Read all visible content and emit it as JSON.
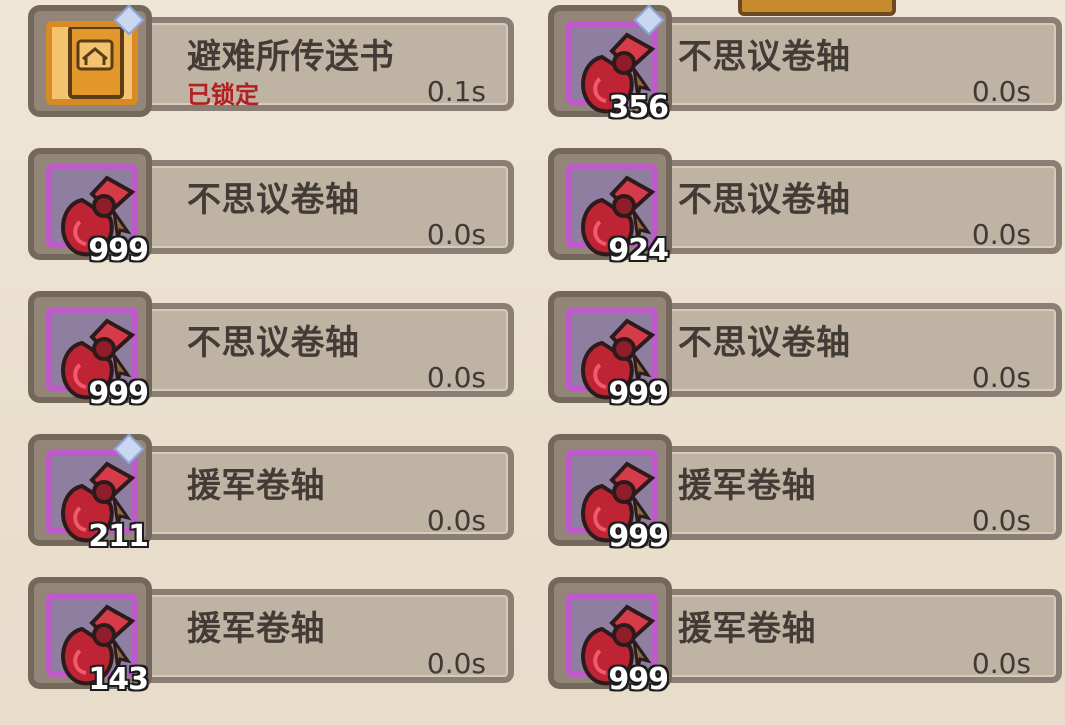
{
  "screen": {
    "background": "#efe6d8",
    "accent_tab": "#c98a2e"
  },
  "items": [
    {
      "name": "避难所传送书",
      "status": "已锁定",
      "time": "0.1s",
      "count": "",
      "icon": "book-icon",
      "side": "left",
      "diamond": true
    },
    {
      "name": "不思议卷轴",
      "status": "",
      "time": "0.0s",
      "count": "356",
      "icon": "scroll-icon",
      "side": "right",
      "diamond": true
    },
    {
      "name": "不思议卷轴",
      "status": "",
      "time": "0.0s",
      "count": "999",
      "icon": "scroll-icon",
      "side": "left",
      "diamond": false
    },
    {
      "name": "不思议卷轴",
      "status": "",
      "time": "0.0s",
      "count": "924",
      "icon": "scroll-icon",
      "side": "right",
      "diamond": false
    },
    {
      "name": "不思议卷轴",
      "status": "",
      "time": "0.0s",
      "count": "999",
      "icon": "scroll-icon",
      "side": "left",
      "diamond": false
    },
    {
      "name": "不思议卷轴",
      "status": "",
      "time": "0.0s",
      "count": "999",
      "icon": "scroll-icon",
      "side": "right",
      "diamond": false
    },
    {
      "name": "援军卷轴",
      "status": "",
      "time": "0.0s",
      "count": "211",
      "icon": "scroll-icon",
      "side": "left",
      "diamond": true
    },
    {
      "name": "援军卷轴",
      "status": "",
      "time": "0.0s",
      "count": "999",
      "icon": "scroll-icon",
      "side": "right",
      "diamond": false
    },
    {
      "name": "援军卷轴",
      "status": "",
      "time": "0.0s",
      "count": "143",
      "icon": "scroll-icon",
      "side": "left",
      "diamond": false
    },
    {
      "name": "援军卷轴",
      "status": "",
      "time": "0.0s",
      "count": "999",
      "icon": "scroll-icon",
      "side": "right",
      "diamond": false
    }
  ]
}
